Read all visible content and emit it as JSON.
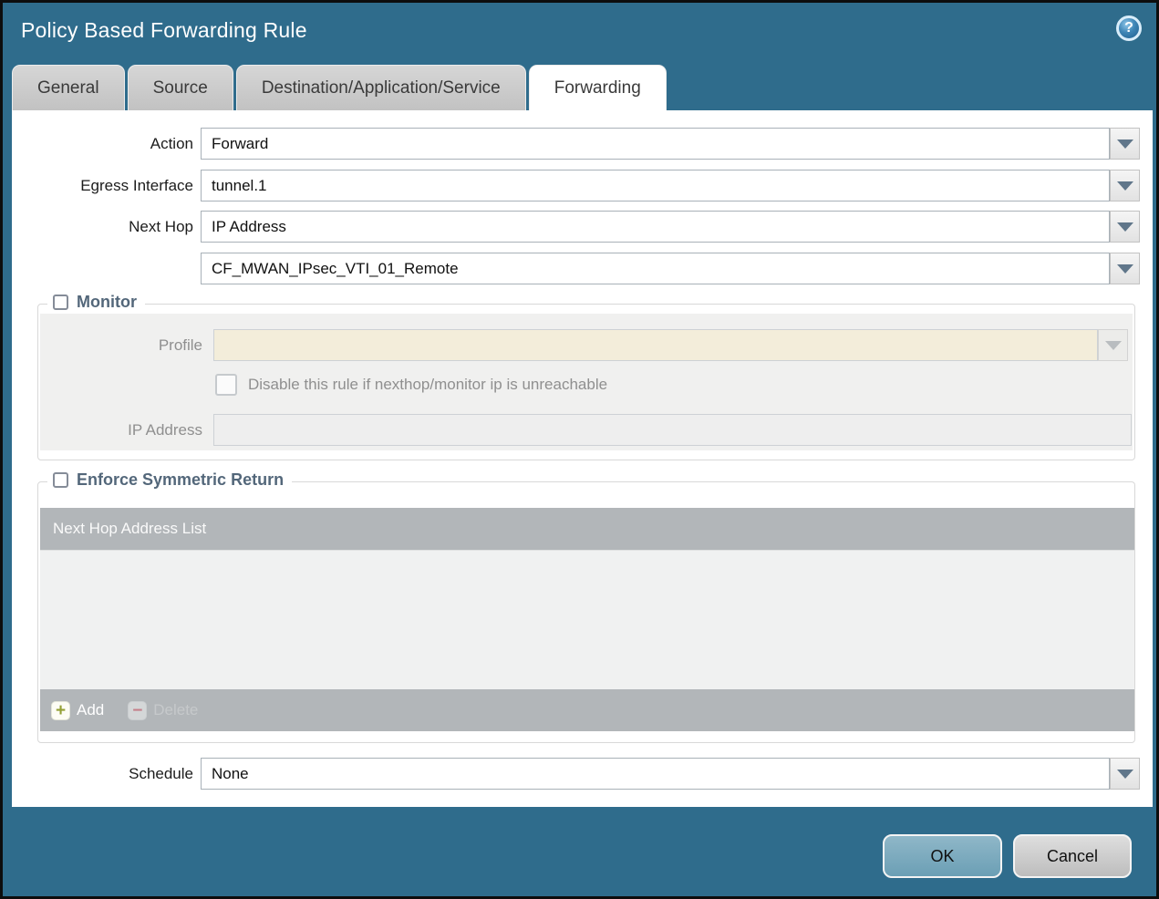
{
  "dialog": {
    "title": "Policy Based Forwarding Rule"
  },
  "icons": {
    "help": "?",
    "add": "+",
    "delete": "−"
  },
  "tabs": [
    {
      "label": "General"
    },
    {
      "label": "Source"
    },
    {
      "label": "Destination/Application/Service"
    },
    {
      "label": "Forwarding"
    }
  ],
  "form": {
    "action": {
      "label": "Action",
      "value": "Forward"
    },
    "egress_interface": {
      "label": "Egress Interface",
      "value": "tunnel.1"
    },
    "next_hop": {
      "label": "Next Hop",
      "value": "IP Address"
    },
    "next_hop_address": {
      "value": "CF_MWAN_IPsec_VTI_01_Remote"
    },
    "schedule": {
      "label": "Schedule",
      "value": "None"
    }
  },
  "monitor": {
    "title": "Monitor",
    "profile": {
      "label": "Profile",
      "value": ""
    },
    "disable_rule": {
      "label": "Disable this rule if nexthop/monitor ip is unreachable",
      "checked": false
    },
    "ip_address": {
      "label": "IP Address",
      "value": ""
    }
  },
  "enforce_symmetric_return": {
    "title": "Enforce Symmetric Return",
    "list_header": "Next Hop Address List",
    "add_label": "Add",
    "delete_label": "Delete"
  },
  "footer": {
    "ok": "OK",
    "cancel": "Cancel"
  },
  "colors": {
    "chrome_teal": "#2f6c8c",
    "ok_fill": "#74a7bc",
    "table_gray": "#b2b6b9",
    "disabled_beige": "#f3edda"
  }
}
